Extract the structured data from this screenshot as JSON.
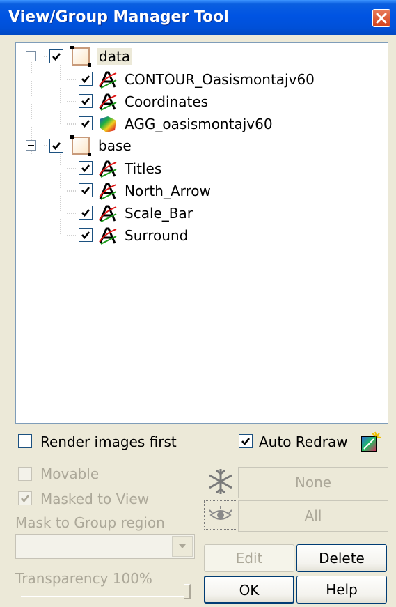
{
  "window": {
    "title": "View/Group Manager Tool"
  },
  "tree": {
    "groups": [
      {
        "label": "data",
        "checked": true,
        "layers": [
          {
            "label": "CONTOUR_Oasismontajv60",
            "icon": "vector-layer-icon",
            "checked": true
          },
          {
            "label": "Coordinates",
            "icon": "vector-layer-icon",
            "checked": true
          },
          {
            "label": "AGG_oasismontajv60",
            "icon": "grid-image-icon",
            "checked": true
          }
        ]
      },
      {
        "label": "base",
        "checked": true,
        "layers": [
          {
            "label": "Titles",
            "icon": "vector-layer-icon",
            "checked": true
          },
          {
            "label": "North_Arrow",
            "icon": "vector-layer-icon",
            "checked": true
          },
          {
            "label": "Scale_Bar",
            "icon": "vector-layer-icon",
            "checked": true
          },
          {
            "label": "Surround",
            "icon": "vector-layer-icon",
            "checked": true
          }
        ]
      }
    ]
  },
  "options": {
    "render_images_first": {
      "label": "Render images first",
      "checked": false
    },
    "auto_redraw": {
      "label": "Auto Redraw",
      "checked": true
    },
    "movable": {
      "label": "Movable",
      "checked": false,
      "enabled": false
    },
    "masked_to_view": {
      "label": "Masked to View",
      "checked": true,
      "enabled": false
    },
    "mask_to_group_region": {
      "label": "Mask to Group region",
      "value": ""
    },
    "transparency": {
      "label": "Transparency 100%",
      "value_percent": 100
    }
  },
  "buttons": {
    "none": "None",
    "all": "All",
    "edit": "Edit",
    "delete": "Delete",
    "ok": "OK",
    "help": "Help"
  },
  "icons": {
    "close": "close-icon",
    "redraw": "redraw-icon",
    "freeze": "snowflake-icon",
    "visibility": "eye-icon"
  },
  "colors": {
    "titlebar": "#0054e3",
    "window_bg": "#ece9d8",
    "disabled_text": "#aca899"
  }
}
